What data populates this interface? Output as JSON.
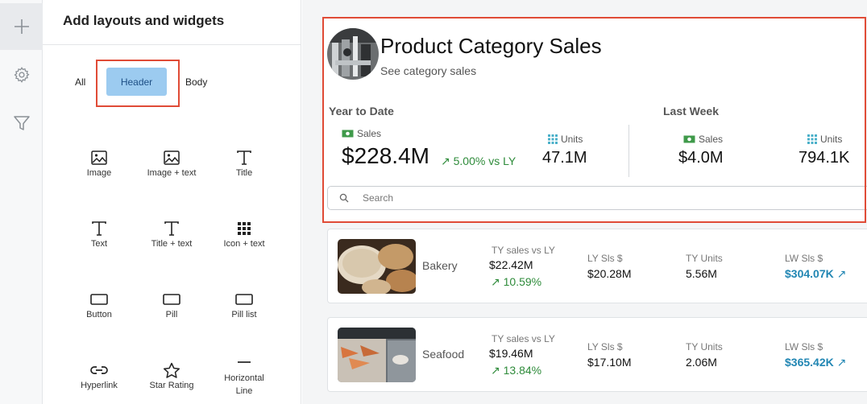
{
  "panel": {
    "title": "Add layouts and widgets",
    "tabs": {
      "all": "All",
      "header": "Header",
      "body": "Body"
    },
    "widgets": [
      {
        "label": "Image",
        "icon": "image-icon"
      },
      {
        "label": "Image + text",
        "icon": "image-text-icon"
      },
      {
        "label": "Title",
        "icon": "title-icon"
      },
      {
        "label": "Text",
        "icon": "text-icon"
      },
      {
        "label": "Title + text",
        "icon": "title-text-icon"
      },
      {
        "label": "Icon + text",
        "icon": "grid-icon"
      },
      {
        "label": "Button",
        "icon": "button-icon"
      },
      {
        "label": "Pill",
        "icon": "pill-icon"
      },
      {
        "label": "Pill list",
        "icon": "pill-list-icon"
      },
      {
        "label": "Hyperlink",
        "icon": "link-icon"
      },
      {
        "label": "Star Rating",
        "icon": "star-icon"
      },
      {
        "label": "Horizontal Line",
        "icon": "horizontal-line-icon"
      }
    ]
  },
  "rail": {
    "icons": [
      "plus-icon",
      "gear-icon",
      "filter-icon"
    ]
  },
  "header": {
    "title": "Product Category Sales",
    "subtitle": "See category sales",
    "ytd": {
      "label": "Year to Date",
      "sales_label": "Sales",
      "sales_value": "$228.4M",
      "delta": "5.00% vs LY",
      "units_label": "Units",
      "units_value": "47.1M"
    },
    "last_week": {
      "label": "Last Week",
      "sales_label": "Sales",
      "sales_value": "$4.0M",
      "units_label": "Units",
      "units_value": "794.1K"
    },
    "search_placeholder": "Search"
  },
  "rows": [
    {
      "name": "Bakery",
      "ty_label": "TY sales vs LY",
      "ty_value": "$22.42M",
      "ty_delta": "10.59%",
      "ly_label": "LY Sls $",
      "ly_value": "$20.28M",
      "units_label": "TY Units",
      "units_value": "5.56M",
      "lw_label": "LW Sls $",
      "lw_value": "$304.07K"
    },
    {
      "name": "Seafood",
      "ty_label": "TY sales vs LY",
      "ty_value": "$19.46M",
      "ty_delta": "13.84%",
      "ly_label": "LY Sls $",
      "ly_value": "$17.10M",
      "units_label": "TY Units",
      "units_value": "2.06M",
      "lw_label": "LW Sls $",
      "lw_value": "$365.42K"
    }
  ],
  "colors": {
    "accent": "#9ccbf0",
    "highlight": "#e04b36",
    "positive": "#2e8b3a",
    "link": "#2186b3"
  }
}
